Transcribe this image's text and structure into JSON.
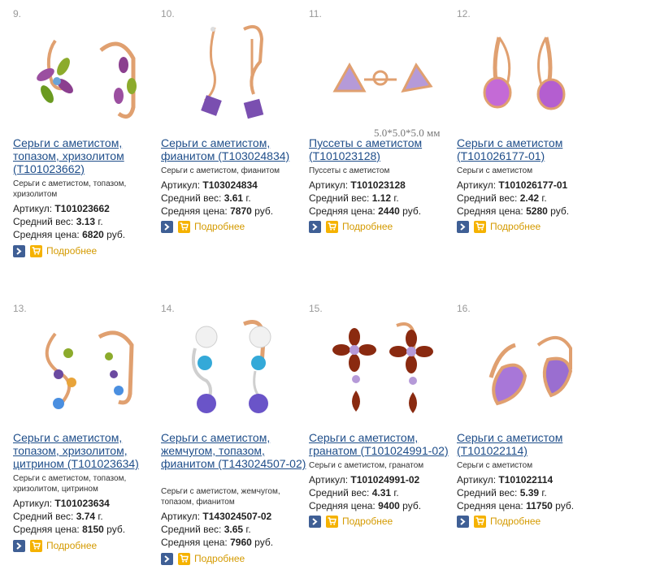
{
  "products": [
    {
      "num": "9.",
      "title": "Серьги с аметистом, топазом, хризолитом (Т101023662)",
      "desc": "Серьги с аметистом, топазом, хризолитом",
      "article_label": "Артикул:",
      "article": "Т101023662",
      "weight_label": "Средний вес:",
      "weight": "3.13",
      "weight_unit": "г.",
      "price_label": "Средняя цена:",
      "price": "6820",
      "price_unit": "руб.",
      "more": "Подробнее"
    },
    {
      "num": "10.",
      "title": "Серьги с аметистом, фианитом (Т103024834)",
      "desc": "Серьги с аметистом, фианитом",
      "article_label": "Артикул:",
      "article": "Т103024834",
      "weight_label": "Средний вес:",
      "weight": "3.61",
      "weight_unit": "г.",
      "price_label": "Средняя цена:",
      "price": "7870",
      "price_unit": "руб.",
      "more": "Подробнее"
    },
    {
      "num": "11.",
      "title": "Пуссеты с аметистом (Т101023128)",
      "desc": "Пуссеты с аметистом",
      "article_label": "Артикул:",
      "article": "Т101023128",
      "weight_label": "Средний вес:",
      "weight": "1.12",
      "weight_unit": "г.",
      "price_label": "Средняя цена:",
      "price": "2440",
      "price_unit": "руб.",
      "more": "Подробнее",
      "image_caption": "5.0*5.0*5.0 мм"
    },
    {
      "num": "12.",
      "title": "Серьги с аметистом (Т101026177-01)",
      "desc": "Серьги с аметистом",
      "article_label": "Артикул:",
      "article": "Т101026177-01",
      "weight_label": "Средний вес:",
      "weight": "2.42",
      "weight_unit": "г.",
      "price_label": "Средняя цена:",
      "price": "5280",
      "price_unit": "руб.",
      "more": "Подробнее"
    },
    {
      "num": "13.",
      "title": "Серьги с аметистом, топазом, хризолитом, цитрином (Т101023634)",
      "desc": "Серьги с аметистом, топазом, хризолитом, цитрином",
      "article_label": "Артикул:",
      "article": "Т101023634",
      "weight_label": "Средний вес:",
      "weight": "3.74",
      "weight_unit": "г.",
      "price_label": "Средняя цена:",
      "price": "8150",
      "price_unit": "руб.",
      "more": "Подробнее"
    },
    {
      "num": "14.",
      "title": "Серьги с аметистом, жемчугом, топазом, фианитом (Т143024507-02)",
      "desc": "Серьги с аметистом, жемчугом, топазом, фианитом",
      "article_label": "Артикул:",
      "article": "Т143024507-02",
      "weight_label": "Средний вес:",
      "weight": "3.65",
      "weight_unit": "г.",
      "price_label": "Средняя цена:",
      "price": "7960",
      "price_unit": "руб.",
      "more": "Подробнее"
    },
    {
      "num": "15.",
      "title": "Серьги с аметистом, гранатом (Т101024991-02)",
      "desc": "Серьги с аметистом, гранатом",
      "article_label": "Артикул:",
      "article": "Т101024991-02",
      "weight_label": "Средний вес:",
      "weight": "4.31",
      "weight_unit": "г.",
      "price_label": "Средняя цена:",
      "price": "9400",
      "price_unit": "руб.",
      "more": "Подробнее"
    },
    {
      "num": "16.",
      "title": "Серьги с аметистом (Т101022114)",
      "desc": "Серьги с аметистом",
      "article_label": "Артикул:",
      "article": "Т101022114",
      "weight_label": "Средний вес:",
      "weight": "5.39",
      "weight_unit": "г.",
      "price_label": "Средняя цена:",
      "price": "11750",
      "price_unit": "руб.",
      "more": "Подробнее"
    }
  ],
  "colors": {
    "link": "#1f4e8a",
    "more": "#d49a00",
    "arrow_btn": "#3f5f95",
    "cart_btn": "#f5b200",
    "gold": "#e0a070"
  },
  "icons": {
    "arrow": "chevron-right-icon",
    "cart": "cart-icon"
  }
}
